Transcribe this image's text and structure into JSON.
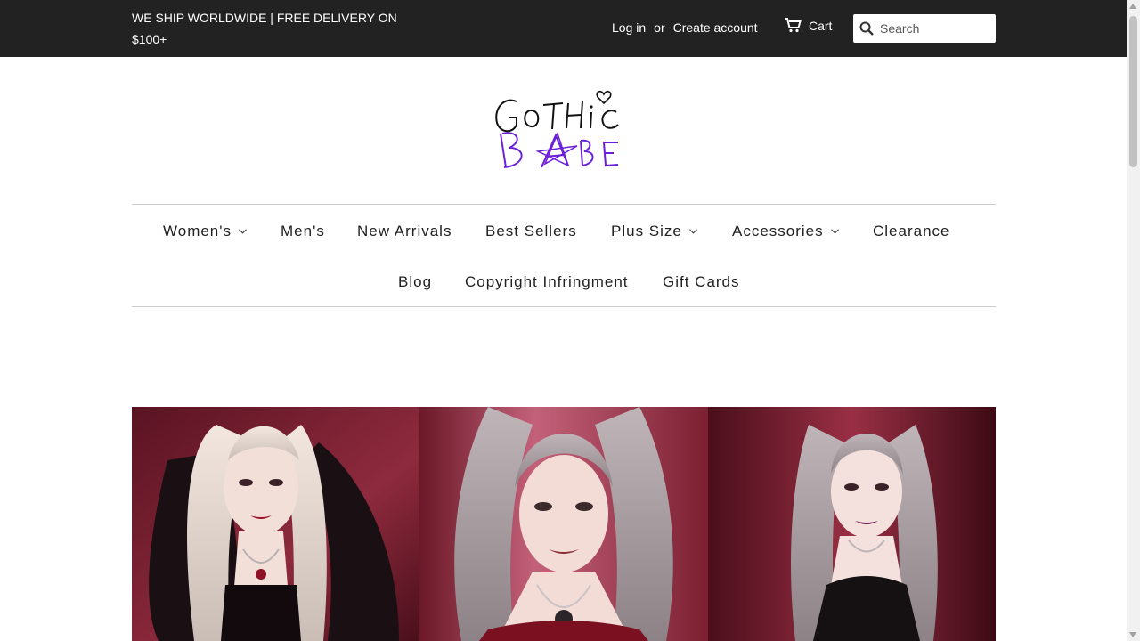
{
  "topbar": {
    "shipping_notice": "WE SHIP WORLDWIDE | FREE DELIVERY ON $100+",
    "login": "Log in",
    "or": "or",
    "create_account": "Create account",
    "cart": "Cart",
    "cart_icon": "cart-icon",
    "search_icon": "search-icon",
    "search_placeholder": "Search",
    "bg_color": "#222222"
  },
  "logo": {
    "line1": "GOTHIC",
    "line2": "BABE",
    "accent_color": "#6a1fd8"
  },
  "nav": {
    "row1": [
      {
        "label": "Women's",
        "dropdown": true
      },
      {
        "label": "Men's",
        "dropdown": false
      },
      {
        "label": "New Arrivals",
        "dropdown": false
      },
      {
        "label": "Best Sellers",
        "dropdown": false
      },
      {
        "label": "Plus Size",
        "dropdown": true
      },
      {
        "label": "Accessories",
        "dropdown": true
      },
      {
        "label": "Clearance",
        "dropdown": false
      }
    ],
    "row2": [
      {
        "label": "Blog",
        "dropdown": false
      },
      {
        "label": "Copyright Infringment",
        "dropdown": false
      },
      {
        "label": "Gift Cards",
        "dropdown": false
      }
    ]
  },
  "hero": {
    "panels": 3,
    "background_tone": "#7a1c2e"
  }
}
